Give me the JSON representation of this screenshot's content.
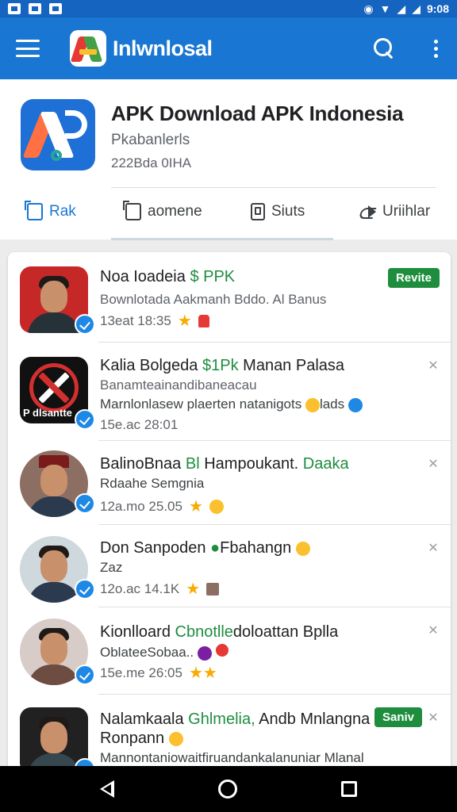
{
  "status_bar": {
    "time": "9:08"
  },
  "app_bar": {
    "title": "Inlwnlosal"
  },
  "app": {
    "name": "APK Download APK Indonesia",
    "subtitle": "Pkabanlerls",
    "meta": "222Bda 0IHA"
  },
  "actions": [
    {
      "label": "Rak"
    },
    {
      "label": "aomene"
    },
    {
      "label": "Siuts"
    },
    {
      "label": "Uriihlar"
    }
  ],
  "list": [
    {
      "title": "Noa Ioadeia",
      "title_green": "$ PPK",
      "line1": "Bownlotada Aakmanh Bddo. Al Banus",
      "time": "13eat  18:35",
      "badge": "Revite"
    },
    {
      "title": "Kalia Bolgeda",
      "title_green": "$1Pk",
      "title_rest": "Manan Palasa",
      "line1": "Banamteainandibaneacau",
      "line2": "Marnlonlasew plaerten natanigots",
      "line2_tail": "lads",
      "time": "15e.ac  28:01",
      "avatar_text": "P dlsantte"
    },
    {
      "title": "BalinoBnaa",
      "title_green": "Bl",
      "title_rest": "Hampoukant.",
      "title_green2": "Daaka",
      "line1": "Rdaahe Semgnia",
      "time": "12a.mo  25.05"
    },
    {
      "title": "Don Sanpoden",
      "title_rest": "Fbahangn",
      "line1": "Zaz",
      "time": "12o.ac  14.1K"
    },
    {
      "title": "Kionlloard",
      "title_green": "Cbnotlle",
      "title_rest": "doloattan Bplla",
      "line1": "OblateeSobaa..",
      "time": "15e.me  26:05"
    },
    {
      "title": "Nalamkaala",
      "title_green": "Ghlmelia,",
      "title_rest": "Andb Mnlangna",
      "line1": "Ronpann",
      "line2": "Mannontaniowaitfiruandankalanuniar Mlanal",
      "badge": "Saniv"
    }
  ]
}
